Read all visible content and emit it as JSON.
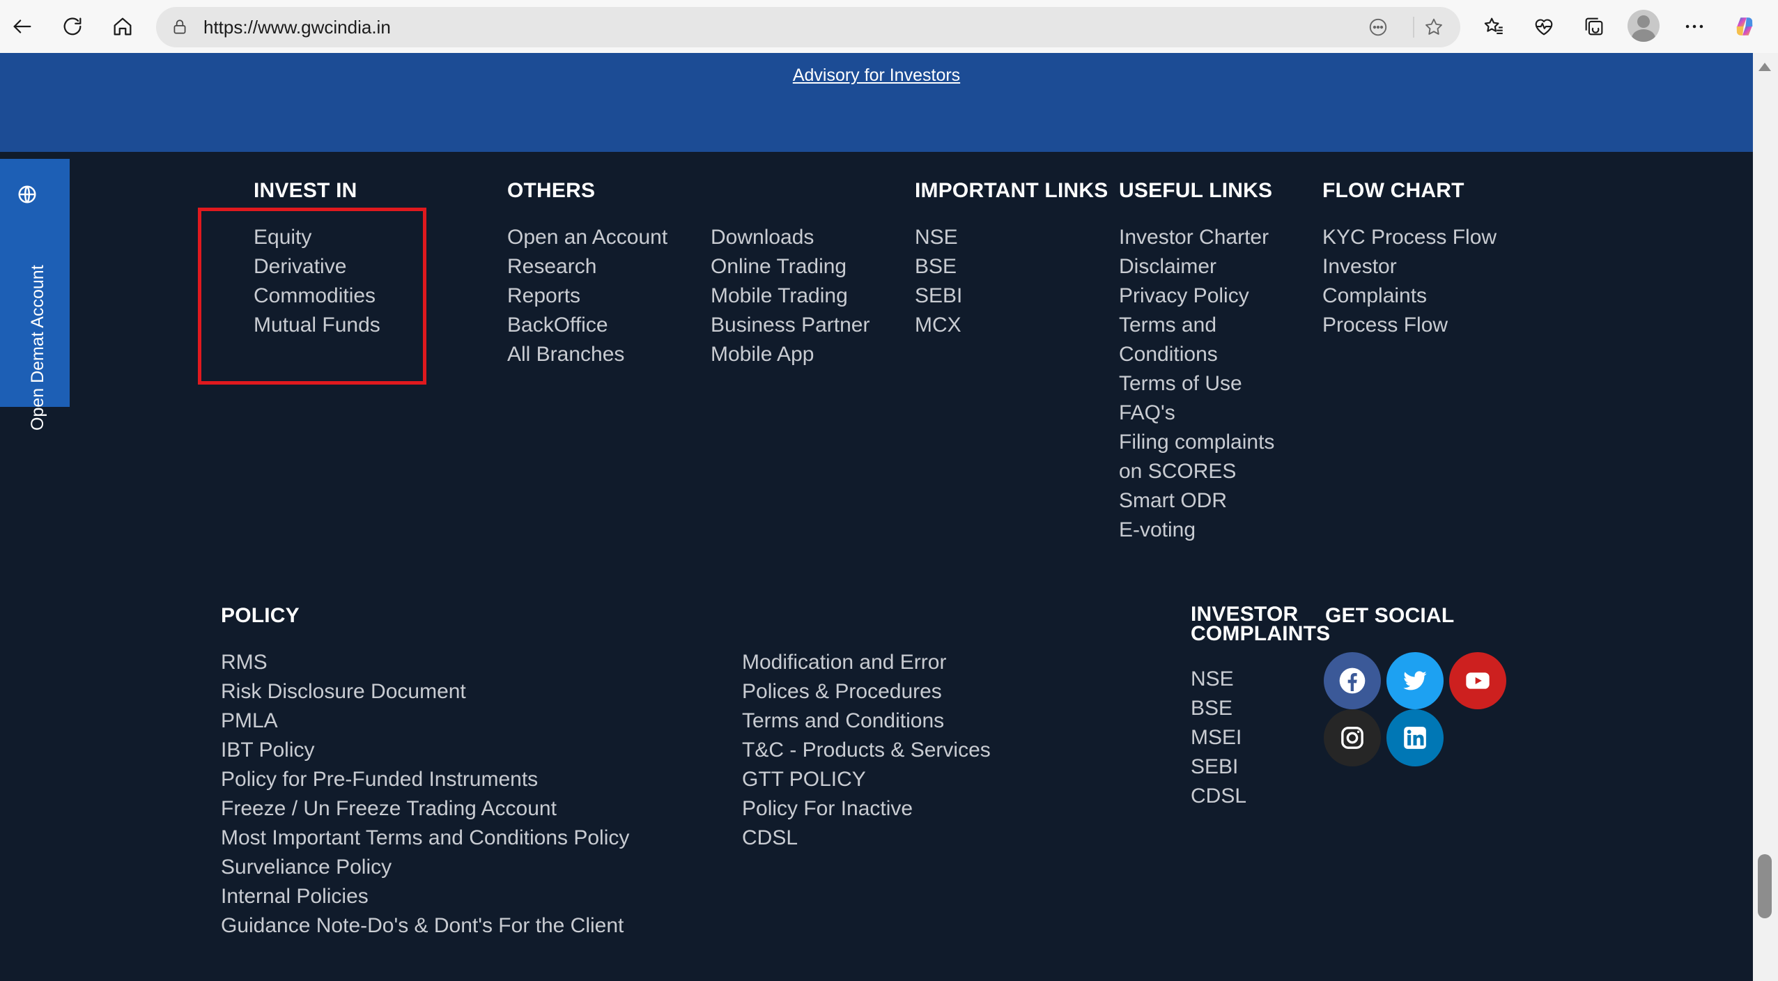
{
  "browser": {
    "url": "https://www.gwcindia.in"
  },
  "page": {
    "advisory_link": "Advisory for Investors",
    "side_tab": "Open Demat Account",
    "invest_in": {
      "title": "INVEST IN",
      "items": [
        "Equity",
        "Derivative",
        "Commodities",
        "Mutual Funds"
      ]
    },
    "others": {
      "title": "OTHERS",
      "items_a": [
        "Open an Account",
        "Research",
        "Reports",
        "BackOffice",
        "All Branches"
      ],
      "items_b": [
        "Downloads",
        "Online Trading",
        "Mobile Trading",
        "Business Partner",
        "Mobile App"
      ]
    },
    "important_links": {
      "title": "IMPORTANT LINKS",
      "items": [
        "NSE",
        "BSE",
        "SEBI",
        "MCX"
      ]
    },
    "useful_links": {
      "title": "USEFUL LINKS",
      "items": [
        "Investor Charter",
        "Disclaimer",
        "Privacy Policy",
        "Terms and",
        "Conditions",
        "Terms of Use",
        "FAQ's",
        "Filing complaints",
        "on SCORES",
        "Smart ODR",
        "E-voting"
      ]
    },
    "flow_chart": {
      "title": "FLOW CHART",
      "items": [
        "KYC Process Flow",
        "Investor",
        "Complaints",
        "Process Flow"
      ]
    },
    "policy": {
      "title": "POLICY",
      "items_a": [
        "RMS",
        "Risk Disclosure Document",
        "PMLA",
        "IBT Policy",
        "Policy for Pre-Funded Instruments",
        "Freeze / Un Freeze Trading Account",
        "Most Important Terms and Conditions Policy",
        "Surveliance Policy",
        "Internal Policies",
        "Guidance Note-Do's & Dont's For the Client"
      ],
      "items_b": [
        "Modification and Error",
        "Polices & Procedures",
        "Terms and Conditions",
        "T&C - Products & Services",
        "GTT POLICY",
        "Policy For Inactive",
        "CDSL"
      ]
    },
    "investor_complaints": {
      "title_line1": "INVESTOR",
      "title_line2": "COMPLAINTS",
      "items": [
        "NSE",
        "BSE",
        "MSEI",
        "SEBI",
        "CDSL"
      ]
    },
    "get_social": {
      "title": "GET SOCIAL",
      "icons": [
        {
          "name": "facebook",
          "color": "#3b5998"
        },
        {
          "name": "twitter",
          "color": "#1da1f2"
        },
        {
          "name": "youtube",
          "color": "#cd201f"
        },
        {
          "name": "instagram",
          "color": "#262626"
        },
        {
          "name": "linkedin",
          "color": "#0077b5"
        }
      ]
    }
  }
}
